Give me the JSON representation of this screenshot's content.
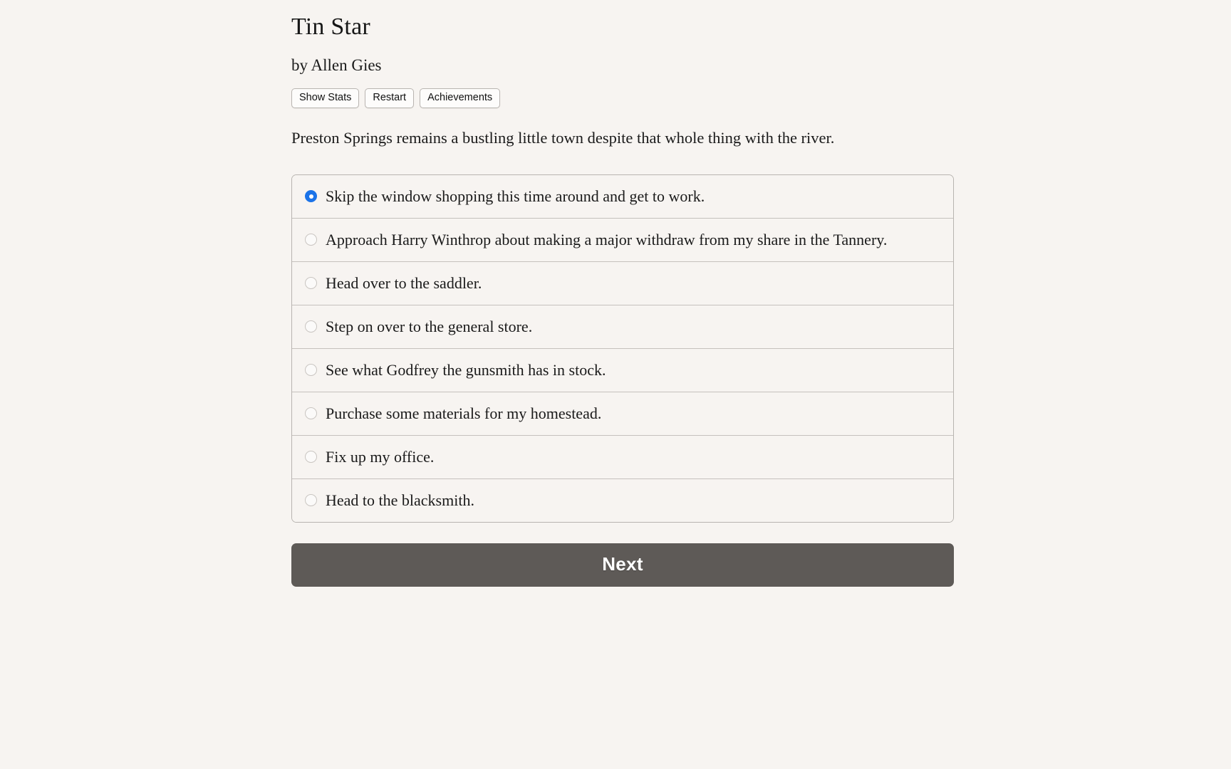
{
  "game": {
    "title": "Tin Star",
    "byline": "by Allen Gies"
  },
  "toolbar": {
    "show_stats_label": "Show Stats",
    "restart_label": "Restart",
    "achievements_label": "Achievements"
  },
  "story": {
    "text": "Preston Springs remains a bustling little town despite that whole thing with the river."
  },
  "choices": {
    "selected_index": 0,
    "options": [
      {
        "label": "Skip the window shopping this time around and get to work."
      },
      {
        "label": "Approach Harry Winthrop about making a major withdraw from my share in the Tannery."
      },
      {
        "label": "Head over to the saddler."
      },
      {
        "label": "Step on over to the general store."
      },
      {
        "label": "See what Godfrey the gunsmith has in stock."
      },
      {
        "label": "Purchase some materials for my homestead."
      },
      {
        "label": "Fix up my office."
      },
      {
        "label": "Head to the blacksmith."
      }
    ]
  },
  "actions": {
    "next_label": "Next"
  },
  "colors": {
    "background": "#f7f4f1",
    "accent_selected_radio": "#1b73e8",
    "next_button": "#5e5a57"
  }
}
